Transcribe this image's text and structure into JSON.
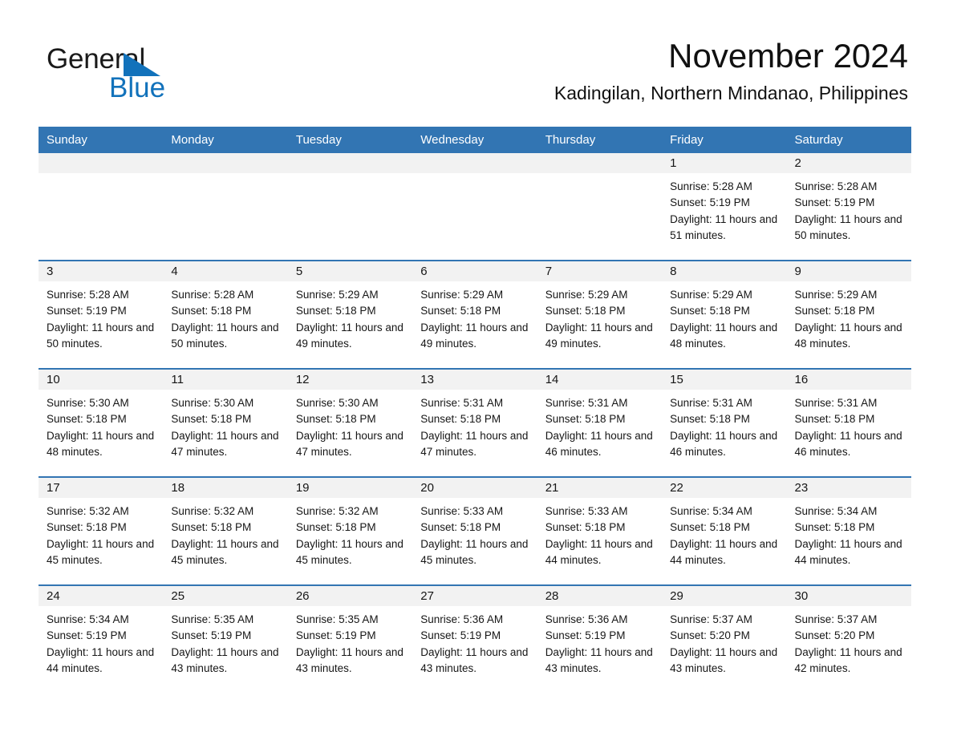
{
  "brand": {
    "name_line1": "General",
    "name_line2": "Blue",
    "accent_color": "#1272bb"
  },
  "header": {
    "month_title": "November 2024",
    "location": "Kadingilan, Northern Mindanao, Philippines"
  },
  "theme": {
    "header_blue": "#3275b3",
    "daynum_band": "#f2f2f2",
    "text": "#161616"
  },
  "calendar": {
    "weekdays": [
      "Sunday",
      "Monday",
      "Tuesday",
      "Wednesday",
      "Thursday",
      "Friday",
      "Saturday"
    ],
    "weeks": [
      [
        {
          "day": "",
          "sunrise": "",
          "sunset": "",
          "daylight": "",
          "blank": true
        },
        {
          "day": "",
          "sunrise": "",
          "sunset": "",
          "daylight": "",
          "blank": true
        },
        {
          "day": "",
          "sunrise": "",
          "sunset": "",
          "daylight": "",
          "blank": true
        },
        {
          "day": "",
          "sunrise": "",
          "sunset": "",
          "daylight": "",
          "blank": true
        },
        {
          "day": "",
          "sunrise": "",
          "sunset": "",
          "daylight": "",
          "blank": true
        },
        {
          "day": "1",
          "sunrise": "Sunrise: 5:28 AM",
          "sunset": "Sunset: 5:19 PM",
          "daylight": "Daylight: 11 hours and 51 minutes."
        },
        {
          "day": "2",
          "sunrise": "Sunrise: 5:28 AM",
          "sunset": "Sunset: 5:19 PM",
          "daylight": "Daylight: 11 hours and 50 minutes."
        }
      ],
      [
        {
          "day": "3",
          "sunrise": "Sunrise: 5:28 AM",
          "sunset": "Sunset: 5:19 PM",
          "daylight": "Daylight: 11 hours and 50 minutes."
        },
        {
          "day": "4",
          "sunrise": "Sunrise: 5:28 AM",
          "sunset": "Sunset: 5:18 PM",
          "daylight": "Daylight: 11 hours and 50 minutes."
        },
        {
          "day": "5",
          "sunrise": "Sunrise: 5:29 AM",
          "sunset": "Sunset: 5:18 PM",
          "daylight": "Daylight: 11 hours and 49 minutes."
        },
        {
          "day": "6",
          "sunrise": "Sunrise: 5:29 AM",
          "sunset": "Sunset: 5:18 PM",
          "daylight": "Daylight: 11 hours and 49 minutes."
        },
        {
          "day": "7",
          "sunrise": "Sunrise: 5:29 AM",
          "sunset": "Sunset: 5:18 PM",
          "daylight": "Daylight: 11 hours and 49 minutes."
        },
        {
          "day": "8",
          "sunrise": "Sunrise: 5:29 AM",
          "sunset": "Sunset: 5:18 PM",
          "daylight": "Daylight: 11 hours and 48 minutes."
        },
        {
          "day": "9",
          "sunrise": "Sunrise: 5:29 AM",
          "sunset": "Sunset: 5:18 PM",
          "daylight": "Daylight: 11 hours and 48 minutes."
        }
      ],
      [
        {
          "day": "10",
          "sunrise": "Sunrise: 5:30 AM",
          "sunset": "Sunset: 5:18 PM",
          "daylight": "Daylight: 11 hours and 48 minutes."
        },
        {
          "day": "11",
          "sunrise": "Sunrise: 5:30 AM",
          "sunset": "Sunset: 5:18 PM",
          "daylight": "Daylight: 11 hours and 47 minutes."
        },
        {
          "day": "12",
          "sunrise": "Sunrise: 5:30 AM",
          "sunset": "Sunset: 5:18 PM",
          "daylight": "Daylight: 11 hours and 47 minutes."
        },
        {
          "day": "13",
          "sunrise": "Sunrise: 5:31 AM",
          "sunset": "Sunset: 5:18 PM",
          "daylight": "Daylight: 11 hours and 47 minutes."
        },
        {
          "day": "14",
          "sunrise": "Sunrise: 5:31 AM",
          "sunset": "Sunset: 5:18 PM",
          "daylight": "Daylight: 11 hours and 46 minutes."
        },
        {
          "day": "15",
          "sunrise": "Sunrise: 5:31 AM",
          "sunset": "Sunset: 5:18 PM",
          "daylight": "Daylight: 11 hours and 46 minutes."
        },
        {
          "day": "16",
          "sunrise": "Sunrise: 5:31 AM",
          "sunset": "Sunset: 5:18 PM",
          "daylight": "Daylight: 11 hours and 46 minutes."
        }
      ],
      [
        {
          "day": "17",
          "sunrise": "Sunrise: 5:32 AM",
          "sunset": "Sunset: 5:18 PM",
          "daylight": "Daylight: 11 hours and 45 minutes."
        },
        {
          "day": "18",
          "sunrise": "Sunrise: 5:32 AM",
          "sunset": "Sunset: 5:18 PM",
          "daylight": "Daylight: 11 hours and 45 minutes."
        },
        {
          "day": "19",
          "sunrise": "Sunrise: 5:32 AM",
          "sunset": "Sunset: 5:18 PM",
          "daylight": "Daylight: 11 hours and 45 minutes."
        },
        {
          "day": "20",
          "sunrise": "Sunrise: 5:33 AM",
          "sunset": "Sunset: 5:18 PM",
          "daylight": "Daylight: 11 hours and 45 minutes."
        },
        {
          "day": "21",
          "sunrise": "Sunrise: 5:33 AM",
          "sunset": "Sunset: 5:18 PM",
          "daylight": "Daylight: 11 hours and 44 minutes."
        },
        {
          "day": "22",
          "sunrise": "Sunrise: 5:34 AM",
          "sunset": "Sunset: 5:18 PM",
          "daylight": "Daylight: 11 hours and 44 minutes."
        },
        {
          "day": "23",
          "sunrise": "Sunrise: 5:34 AM",
          "sunset": "Sunset: 5:18 PM",
          "daylight": "Daylight: 11 hours and 44 minutes."
        }
      ],
      [
        {
          "day": "24",
          "sunrise": "Sunrise: 5:34 AM",
          "sunset": "Sunset: 5:19 PM",
          "daylight": "Daylight: 11 hours and 44 minutes."
        },
        {
          "day": "25",
          "sunrise": "Sunrise: 5:35 AM",
          "sunset": "Sunset: 5:19 PM",
          "daylight": "Daylight: 11 hours and 43 minutes."
        },
        {
          "day": "26",
          "sunrise": "Sunrise: 5:35 AM",
          "sunset": "Sunset: 5:19 PM",
          "daylight": "Daylight: 11 hours and 43 minutes."
        },
        {
          "day": "27",
          "sunrise": "Sunrise: 5:36 AM",
          "sunset": "Sunset: 5:19 PM",
          "daylight": "Daylight: 11 hours and 43 minutes."
        },
        {
          "day": "28",
          "sunrise": "Sunrise: 5:36 AM",
          "sunset": "Sunset: 5:19 PM",
          "daylight": "Daylight: 11 hours and 43 minutes."
        },
        {
          "day": "29",
          "sunrise": "Sunrise: 5:37 AM",
          "sunset": "Sunset: 5:20 PM",
          "daylight": "Daylight: 11 hours and 43 minutes."
        },
        {
          "day": "30",
          "sunrise": "Sunrise: 5:37 AM",
          "sunset": "Sunset: 5:20 PM",
          "daylight": "Daylight: 11 hours and 42 minutes."
        }
      ]
    ]
  }
}
